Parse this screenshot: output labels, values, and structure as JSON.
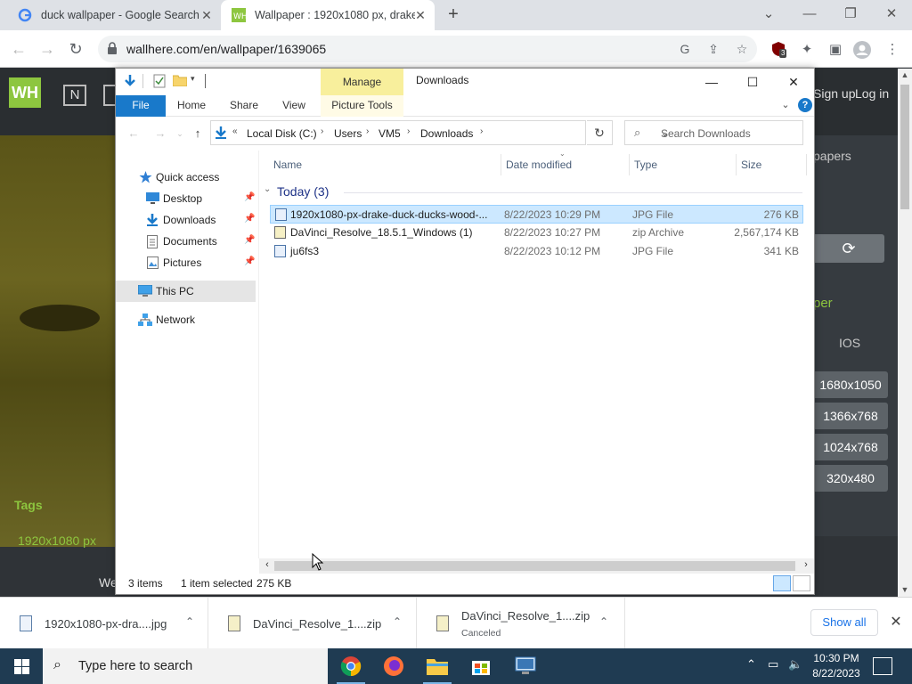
{
  "browser": {
    "tabs": [
      {
        "title": "duck wallpaper - Google Search",
        "active": false
      },
      {
        "title": "Wallpaper : 1920x1080 px, drake",
        "active": true
      }
    ],
    "url": "wallhere.com/en/wallpaper/1639065",
    "extension_badge": "3"
  },
  "website": {
    "header_links": [
      "Sign up",
      "Log in"
    ],
    "tags_label": "Tags",
    "tag_item": "1920x1080 px",
    "footer_text": "We",
    "right_column": {
      "text_top": "papers",
      "green_text": "per",
      "ios_label": "IOS",
      "resolutions": [
        "1680x1050",
        "1366x768",
        "1024x768",
        "320x480"
      ]
    }
  },
  "explorer": {
    "window_title": "Downloads",
    "contextual_group": "Manage",
    "ribbon_tabs": [
      "File",
      "Home",
      "Share",
      "View",
      "Picture Tools"
    ],
    "breadcrumbs": [
      "Local Disk (C:)",
      "Users",
      "VM5",
      "Downloads"
    ],
    "search_placeholder": "Search Downloads",
    "nav": {
      "quick_access": "Quick access",
      "items": [
        "Desktop",
        "Downloads",
        "Documents",
        "Pictures"
      ],
      "this_pc": "This PC",
      "network": "Network"
    },
    "columns": [
      "Name",
      "Date modified",
      "Type",
      "Size"
    ],
    "group_label": "Today (3)",
    "files": [
      {
        "name": "1920x1080-px-drake-duck-ducks-wood-...",
        "date": "8/22/2023 10:29 PM",
        "type": "JPG File",
        "size": "276 KB",
        "selected": true,
        "kind": "image"
      },
      {
        "name": "DaVinci_Resolve_18.5.1_Windows (1)",
        "date": "8/22/2023 10:27 PM",
        "type": "zip Archive",
        "size": "2,567,174 KB",
        "selected": false,
        "kind": "zip"
      },
      {
        "name": "ju6fs3",
        "date": "8/22/2023 10:12 PM",
        "type": "JPG File",
        "size": "341 KB",
        "selected": false,
        "kind": "image"
      }
    ],
    "status": {
      "items": "3 items",
      "selected": "1 item selected",
      "size": "275 KB"
    }
  },
  "downloads_bar": {
    "items": [
      {
        "name": "1920x1080-px-dra....jpg",
        "sub": ""
      },
      {
        "name": "DaVinci_Resolve_1....zip",
        "sub": ""
      },
      {
        "name": "DaVinci_Resolve_1....zip",
        "sub": "Canceled"
      }
    ],
    "show_all": "Show all"
  },
  "taskbar": {
    "search_placeholder": "Type here to search",
    "time": "10:30 PM",
    "date": "8/22/2023"
  },
  "colors": {
    "accent": "#1979ca",
    "selection": "#cce8ff",
    "wallhere_green": "#8dc63f"
  }
}
